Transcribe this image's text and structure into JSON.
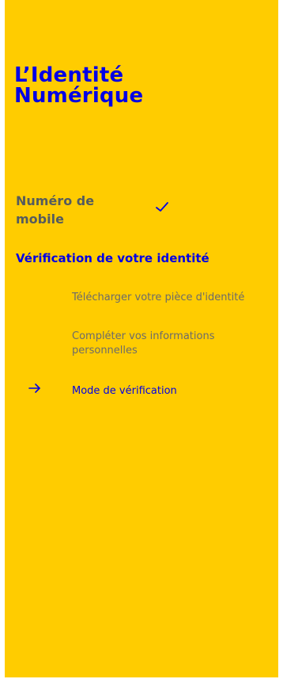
{
  "brand": {
    "line1": "L’Identité",
    "line2": "Numérique"
  },
  "steps": [
    {
      "label": "Numéro de mobile",
      "status": "completed",
      "status_icon": "check-icon"
    },
    {
      "label": "Vérification de votre identité",
      "status": "current",
      "substeps": [
        {
          "label": "Télécharger votre pièce d'identité",
          "status": "pending"
        },
        {
          "label": "Compléter vos informations personnelles",
          "status": "pending"
        },
        {
          "label": "Mode de vérification",
          "status": "current",
          "indicator_icon": "arrow-right-icon"
        }
      ]
    }
  ],
  "colors": {
    "panel_background": "#ffcc00",
    "accent": "#0000e6",
    "completed_text": "#555b5e",
    "pending_text": "#6b6b6b"
  }
}
